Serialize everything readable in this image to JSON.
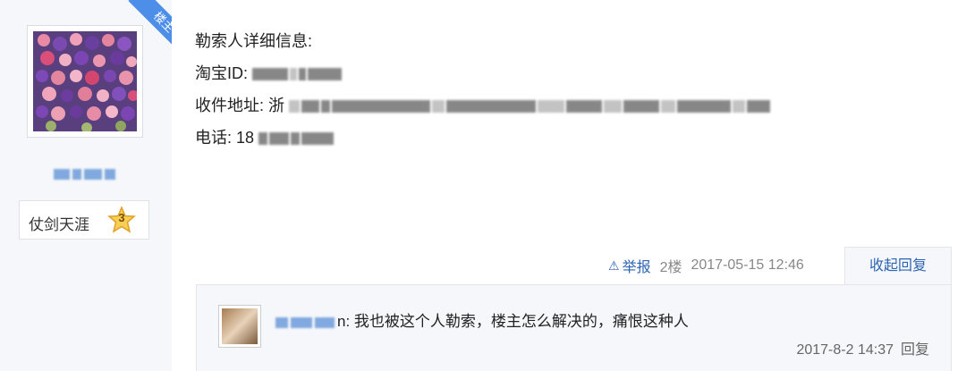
{
  "owner_badge": "楼主",
  "user": {
    "rank_name": "仗剑天涯",
    "rank_level": "3"
  },
  "post": {
    "lines": [
      {
        "label": "勒索人详细信息:"
      },
      {
        "label": "淘宝ID:"
      },
      {
        "label": "收件地址: 浙"
      },
      {
        "label": "电话: 18"
      }
    ]
  },
  "footer": {
    "report_label": "举报",
    "floor": "2楼",
    "timestamp": "2017-05-15 12:46",
    "collapse_label": "收起回复"
  },
  "reply": {
    "name_suffix": "n:",
    "text": "我也被这个人勒索，楼主怎么解决的，痛恨这种人",
    "timestamp": "2017-8-2 14:37",
    "reply_label": "回复"
  },
  "colors": {
    "accent": "#2d64b3",
    "badge": "#4d8fe8",
    "panel_bg": "#f5f7fa"
  }
}
